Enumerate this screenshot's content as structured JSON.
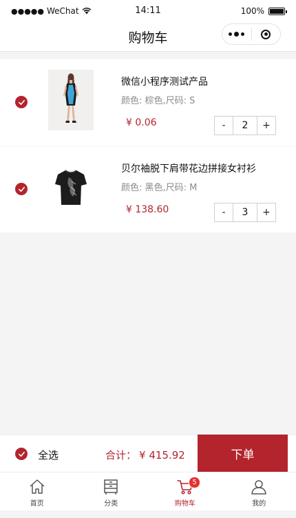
{
  "status_bar": {
    "signal": "●●●●●",
    "carrier": "WeChat",
    "time": "14:11",
    "battery": "100%"
  },
  "nav": {
    "title": "购物车"
  },
  "cart": {
    "items": [
      {
        "title": "微信小程序测试产品",
        "spec": "颜色: 棕色,尺码: S",
        "price": "¥ 0.06",
        "qty": "2",
        "minus": "-",
        "plus": "+"
      },
      {
        "title": "贝尔袖脱下肩带花边拼接女衬衫",
        "spec": "颜色: 黑色,尺码: M",
        "price": "¥ 138.60",
        "qty": "3",
        "minus": "-",
        "plus": "+"
      }
    ]
  },
  "checkout": {
    "select_all": "全选",
    "total_label": "合计：",
    "total_amount": "¥ 415.92",
    "order_button": "下单"
  },
  "tab_bar": {
    "items": [
      {
        "label": "首页",
        "icon": "home-icon"
      },
      {
        "label": "分类",
        "icon": "category-icon"
      },
      {
        "label": "购物车",
        "icon": "cart-icon",
        "badge": "5"
      },
      {
        "label": "我的",
        "icon": "user-icon"
      }
    ],
    "active_index": 2
  },
  "colors": {
    "accent": "#b3242d",
    "badge": "#e62f2f",
    "background": "#f4f4f4"
  }
}
